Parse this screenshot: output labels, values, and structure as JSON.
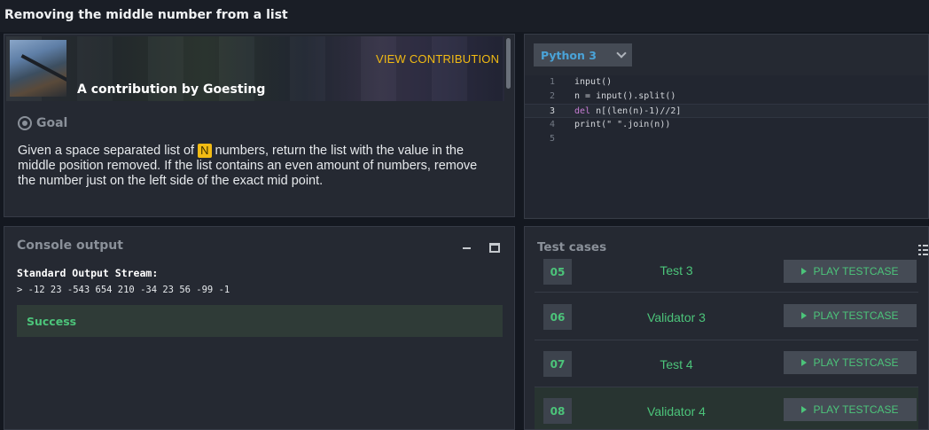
{
  "page": {
    "title": "Removing the middle number from a list"
  },
  "statement": {
    "view_contribution": "VIEW CONTRIBUTION",
    "contribution_by": "A contribution by Goesting",
    "goal_label": "Goal",
    "text_before": "Given a space separated list of ",
    "variable": "N",
    "text_after": " numbers, return the list with the value in the middle position removed. If the list contains an even amount of numbers, remove the number just on the left side of the exact mid point."
  },
  "editor": {
    "language": "Python 3",
    "lines": [
      {
        "n": "1",
        "code": "input()"
      },
      {
        "n": "2",
        "code": "n = input().split()"
      },
      {
        "n": "3",
        "kw": "del",
        "code": " n[(len(n)-1)//2]"
      },
      {
        "n": "4",
        "code": "print(\" \".join(n))"
      },
      {
        "n": "5",
        "code": ""
      }
    ],
    "active_line": 3
  },
  "console": {
    "title": "Console output",
    "stream_label": "Standard Output Stream:",
    "output": "> -12 23 -543 654 210 -34 23 56 -99 -1",
    "status": "Success"
  },
  "testcases": {
    "title": "Test cases",
    "play_label": "PLAY TESTCASE",
    "rows": [
      {
        "num": "05",
        "name": "Test 3"
      },
      {
        "num": "06",
        "name": "Validator 3"
      },
      {
        "num": "07",
        "name": "Test 4"
      },
      {
        "num": "08",
        "name": "Validator 4"
      }
    ]
  },
  "colors": {
    "accent_yellow": "#f2bb13",
    "success_green": "#4cc47a",
    "language_blue": "#4aa3d8",
    "panel_bg": "#252932"
  }
}
